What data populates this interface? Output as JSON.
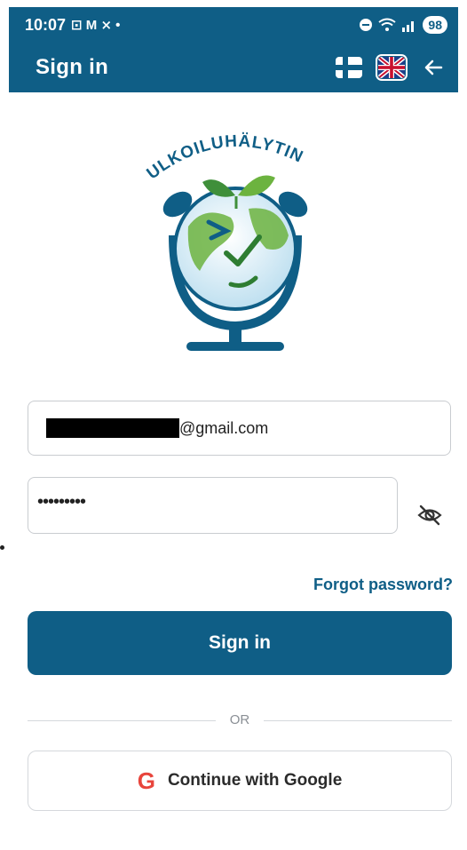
{
  "status_bar": {
    "time": "10:07",
    "notif_icons": "⊡ M ⨯ •",
    "battery": "98"
  },
  "app_bar": {
    "title": "Sign in",
    "languages": [
      {
        "code": "fi",
        "icon": "finland-flag-icon"
      },
      {
        "code": "en",
        "icon": "uk-flag-icon",
        "selected": true
      }
    ]
  },
  "logo": {
    "text": "ULKOILUHÄLYTIN"
  },
  "form": {
    "email_suffix": "@gmail.com",
    "password_masked": "•••••••••",
    "forgot_password": "Forgot password?",
    "sign_in_label": "Sign in",
    "or_label": "OR",
    "google_label": "Continue with Google",
    "google_letter": "G"
  },
  "colors": {
    "primary": "#0f5e86",
    "google_red": "#e8453c",
    "logo_green": "#6cb33f"
  }
}
